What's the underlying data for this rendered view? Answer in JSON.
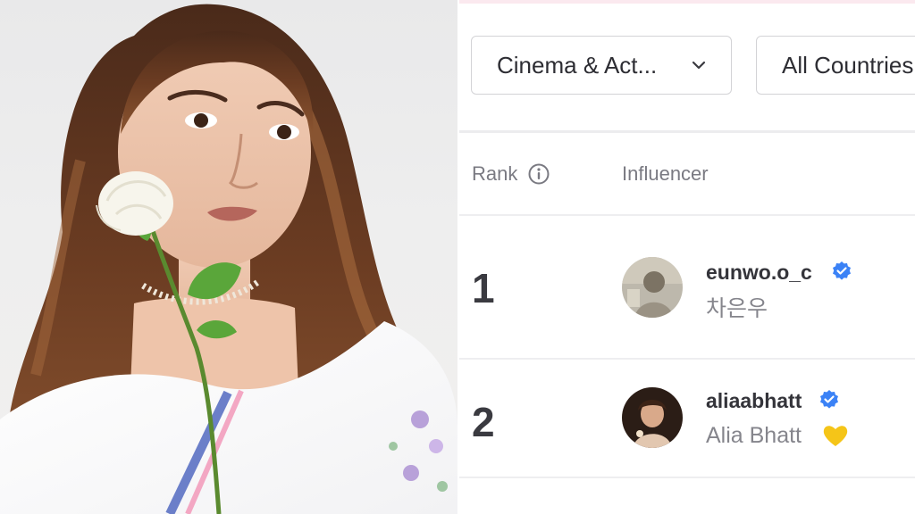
{
  "filters": {
    "category_label": "Cinema & Act...",
    "country_label": "All Countries"
  },
  "table": {
    "headers": {
      "rank": "Rank",
      "influencer": "Influencer"
    },
    "rows": [
      {
        "rank": "1",
        "handle": "eunwo.o_c",
        "display_name": "차은우",
        "verified": true
      },
      {
        "rank": "2",
        "handle": "aliaabhatt",
        "display_name": "Alia Bhatt",
        "verified": true,
        "name_emoji": "yellow-heart"
      }
    ]
  },
  "colors": {
    "verified_badge": "#3b82f6",
    "header_text": "#7a7a82",
    "heart": "#f5c518"
  },
  "icons": [
    "chevron-down-icon",
    "info-icon",
    "verified-badge-icon",
    "yellow-heart-icon"
  ]
}
